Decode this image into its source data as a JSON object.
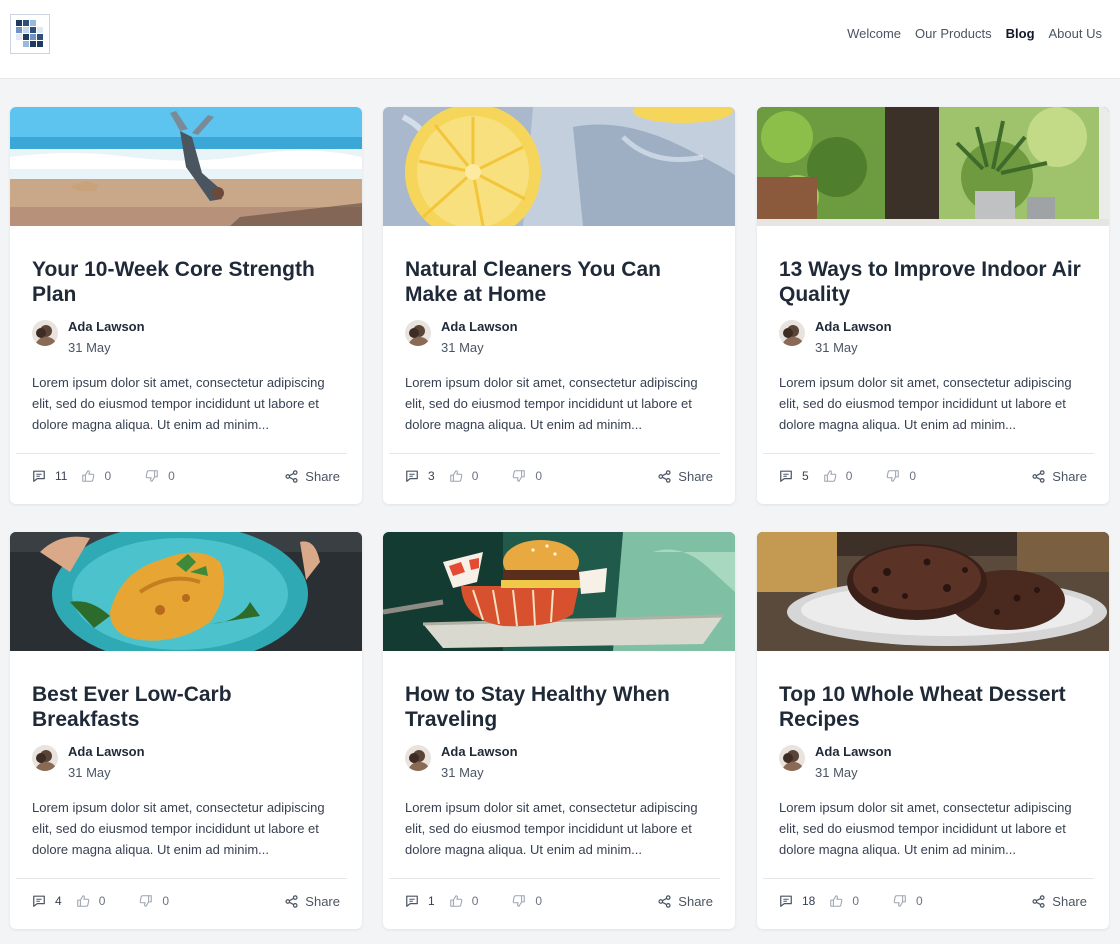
{
  "nav": {
    "items": [
      "Welcome",
      "Our Products",
      "Blog",
      "About Us"
    ],
    "active": "Blog"
  },
  "icons": {
    "logo": "grid-logo-icon",
    "comments": "comment-icon",
    "likes": "thumbs-up-icon",
    "dislikes": "thumbs-down-icon",
    "share": "share-icon"
  },
  "colors": {
    "accent_text": "#1f2937",
    "muted_text": "#6b7280",
    "page_background": "#f3f4f6"
  },
  "posts": [
    {
      "image": "beach-handstand-photo",
      "title": "Your 10-Week Core Strength Plan",
      "author": "Ada Lawson",
      "date": "31 May",
      "excerpt": "Lorem ipsum dolor sit amet, consectetur adipiscing elit, sed do eiusmod tempor incididunt ut labore et dolore magna aliqua. Ut enim ad minim...",
      "comments": "11",
      "likes": "0",
      "dislikes": "0",
      "share": "Share"
    },
    {
      "image": "lemon-water-photo",
      "title": "Natural Cleaners You Can Make at Home",
      "author": "Ada Lawson",
      "date": "31 May",
      "excerpt": "Lorem ipsum dolor sit amet, consectetur adipiscing elit, sed do eiusmod tempor incididunt ut labore et dolore magna aliqua. Ut enim ad minim...",
      "comments": "3",
      "likes": "0",
      "dislikes": "0",
      "share": "Share"
    },
    {
      "image": "window-plants-photo",
      "title": "13 Ways to Improve Indoor Air Quality",
      "author": "Ada Lawson",
      "date": "31 May",
      "excerpt": "Lorem ipsum dolor sit amet, consectetur adipiscing elit, sed do eiusmod tempor incididunt ut labore et dolore magna aliqua. Ut enim ad minim...",
      "comments": "5",
      "likes": "0",
      "dislikes": "0",
      "share": "Share"
    },
    {
      "image": "omelette-plate-photo",
      "title": "Best Ever Low-Carb Breakfasts",
      "author": "Ada Lawson",
      "date": "31 May",
      "excerpt": "Lorem ipsum dolor sit amet, consectetur adipiscing elit, sed do eiusmod tempor incididunt ut labore et dolore magna aliqua. Ut enim ad minim...",
      "comments": "4",
      "likes": "0",
      "dislikes": "0",
      "share": "Share"
    },
    {
      "image": "burger-basket-photo",
      "title": "How to Stay Healthy When Traveling",
      "author": "Ada Lawson",
      "date": "31 May",
      "excerpt": "Lorem ipsum dolor sit amet, consectetur adipiscing elit, sed do eiusmod tempor incididunt ut labore et dolore magna aliqua. Ut enim ad minim...",
      "comments": "1",
      "likes": "0",
      "dislikes": "0",
      "share": "Share"
    },
    {
      "image": "chocolate-cookies-photo",
      "title": "Top 10 Whole Wheat Dessert Recipes",
      "author": "Ada Lawson",
      "date": "31 May",
      "excerpt": "Lorem ipsum dolor sit amet, consectetur adipiscing elit, sed do eiusmod tempor incididunt ut labore et dolore magna aliqua. Ut enim ad minim...",
      "comments": "18",
      "likes": "0",
      "dislikes": "0",
      "share": "Share"
    }
  ]
}
